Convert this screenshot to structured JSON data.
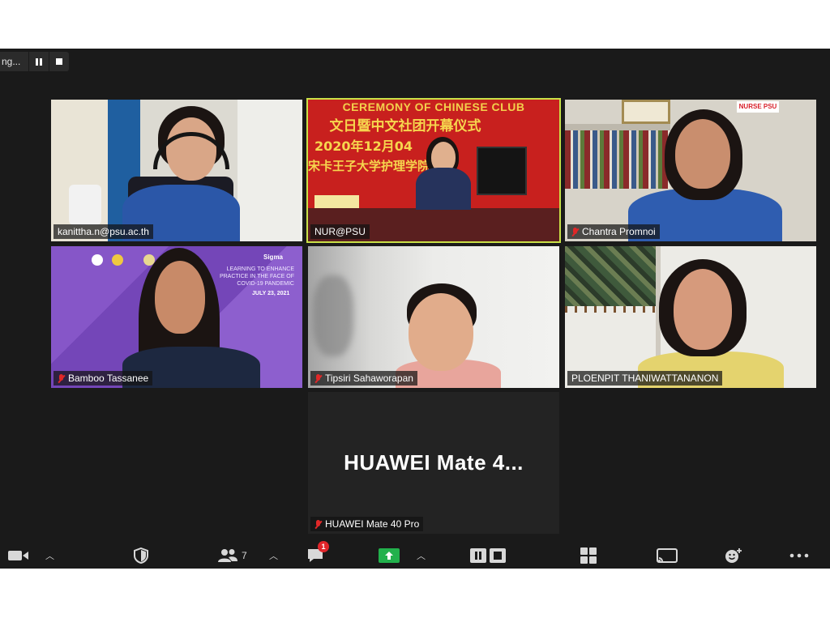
{
  "recording": {
    "status_text": "ng..."
  },
  "participants": [
    {
      "name": "kanittha.n@psu.ac.th",
      "muted": false,
      "active": false
    },
    {
      "name": "NUR@PSU",
      "muted": false,
      "active": true
    },
    {
      "name": "Chantra Promnoi",
      "muted": true,
      "active": false
    },
    {
      "name": "Bamboo Tassanee",
      "muted": true,
      "active": false
    },
    {
      "name": "Tipsiri Sahaworapan",
      "muted": true,
      "active": false
    },
    {
      "name": "PLOENPIT THANIWATTANANON",
      "muted": false,
      "active": false
    },
    {
      "name": "HUAWEI Mate 40 Pro",
      "display_name": "HUAWEI Mate 4...",
      "muted": true,
      "active": false
    }
  ],
  "scene_text": {
    "banner_line1": "CEREMONY OF CHINESE CLUB",
    "banner_line2": "文日暨中文社团开幕仪式",
    "banner_line3": "2020年12月04",
    "banner_line4": "宋卡王子大学护理学院",
    "badge_nurse": "NURSE PSU",
    "poster_date": "JULY 23, 2021",
    "poster_text1": "LEARNING TO ENHANCE",
    "poster_text2": "PRACTICE IN THE FACE OF",
    "poster_text3": "COVID-19 PANDEMIC",
    "poster_logo": "Sigma"
  },
  "toolbar": {
    "participants_count": "7",
    "chat_badge": "1"
  },
  "colors": {
    "active_border": "#c9e047",
    "share_green": "#22b14c",
    "muted_red": "#e02828",
    "badge_red": "#e0262b"
  }
}
